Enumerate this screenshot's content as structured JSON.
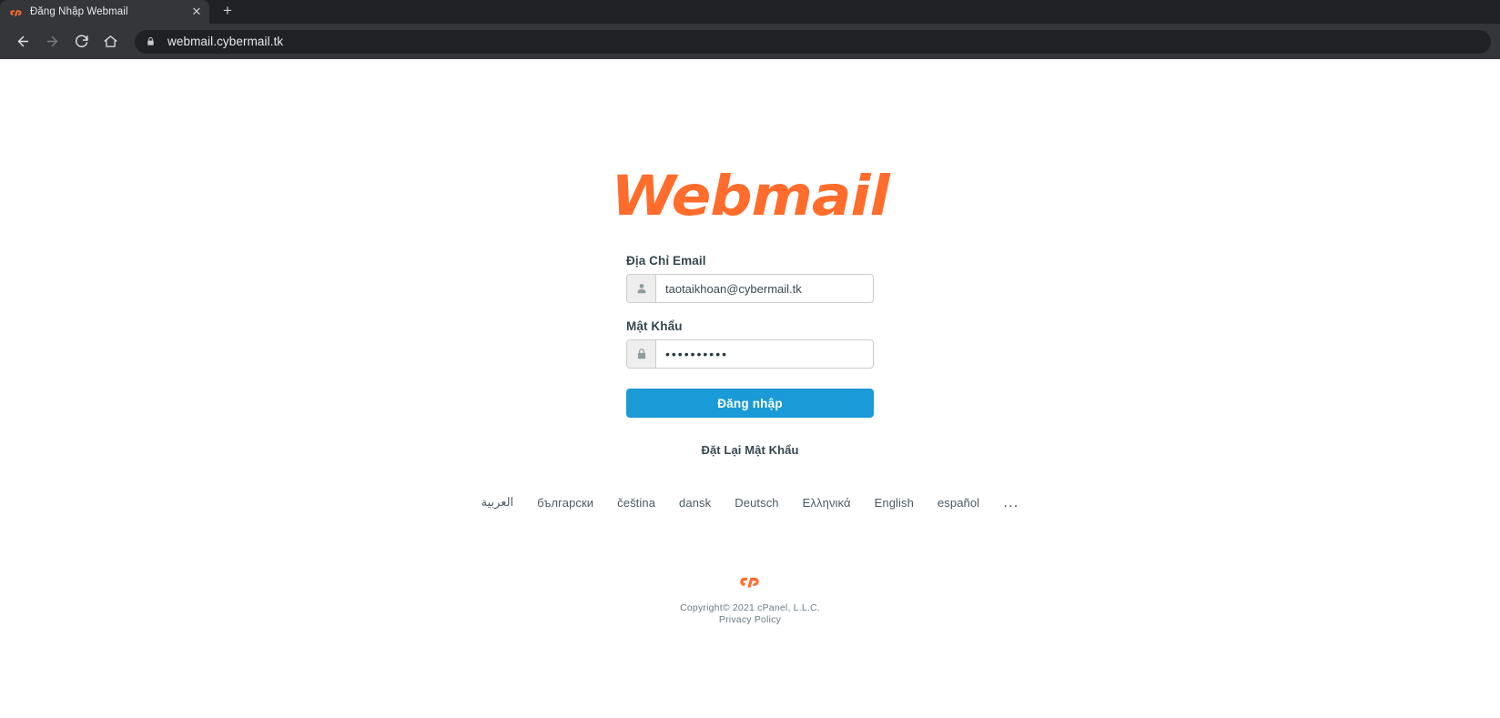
{
  "browser": {
    "tab": {
      "title": "Đăng Nhập Webmail",
      "favicon_name": "cpanel-favicon",
      "close_label": "✕"
    },
    "new_tab_label": "+",
    "nav": {
      "back_label": "←",
      "forward_label": "→",
      "reload_label": "⟳",
      "home_label": "⌂"
    },
    "omnibox": {
      "url": "webmail.cybermail.tk",
      "lock_icon": "lock-icon"
    }
  },
  "page": {
    "logo_text": "Webmail",
    "brand_color": "#ff6c2c",
    "accent_color": "#1a9ad7",
    "email": {
      "label": "Địa Chỉ Email",
      "value": "taotaikhoan@cybermail.tk",
      "placeholder": "Địa Chỉ Email",
      "icon": "user-icon"
    },
    "password": {
      "label": "Mật Khẩu",
      "value": "••••••••••",
      "placeholder": "Mật Khẩu",
      "icon": "lock-icon"
    },
    "login_button": "Đăng nhập",
    "reset_link": "Đặt Lại Mật Khẩu",
    "languages": [
      "العربية",
      "български",
      "čeština",
      "dansk",
      "Deutsch",
      "Ελληνικά",
      "English",
      "español"
    ],
    "languages_more": "...",
    "footer": {
      "logo_text": "cP",
      "copyright": "Copyright© 2021 cPanel, L.L.C.",
      "privacy": "Privacy Policy"
    }
  }
}
